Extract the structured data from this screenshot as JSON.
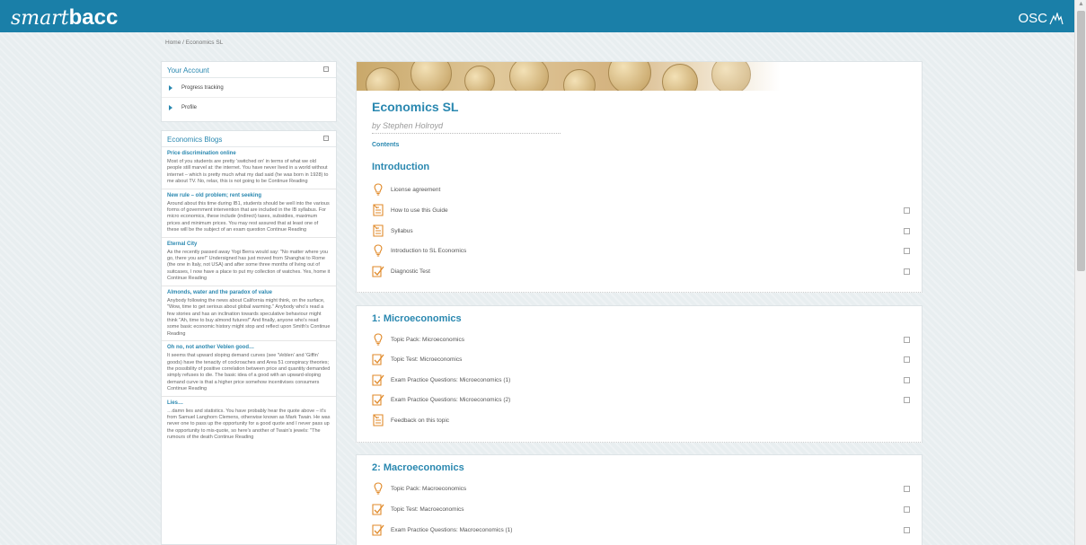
{
  "header": {
    "logo_smart": "smart",
    "logo_bacc": "bacc",
    "osc": "OSC"
  },
  "breadcrumb": {
    "home": "Home",
    "sep": " / ",
    "current": "Economics SL"
  },
  "account": {
    "title": "Your Account",
    "items": [
      {
        "label": "Progress tracking"
      },
      {
        "label": "Profile"
      }
    ]
  },
  "blogs": {
    "title": "Economics Blogs",
    "entries": [
      {
        "title": "Price discrimination online",
        "text": "Most of you students are pretty 'switched on' in terms of what we old people still marvel at: the internet. You have never lived in a world without internet – which is pretty much what my dad said (he was born in 1928) to me about TV. No, relax, this is not going to be Continue Reading"
      },
      {
        "title": "New rule – old problem; rent seeking",
        "text": "Around about this time during IB1, students should be well into the various forms of government intervention that are included in the IB syllabus. For micro economics, these include (indirect) taxes, subsidies, maximum prices and minimum prices. You may rest assured that at least one of these will be the subject of an exam question Continue Reading"
      },
      {
        "title": "Eternal City",
        "text": "As the recently passed away Yogi Berra would say: \"No matter where you go, there you are!\" Undersigned has just moved from Shanghai to Rome (the one in Italy, not USA) and after some three months of living out of suitcases, I now have a place to put my collection of watches. Yes, home it Continue Reading"
      },
      {
        "title": "Almonds, water and the paradox of value",
        "text": "Anybody following the news about California might think, on the surface, \"Wow, time to get serious about global warming.\" Anybody who's read a few stories and has an inclination towards speculative behaviour might think \"Ah, time to buy almond futures!\" And finally, anyone who's read some basic economic history might stop and reflect upon Smith's Continue Reading"
      },
      {
        "title": "Oh no, not another Veblen good…",
        "text": "It seems that upward sloping demand curves (see 'Veblen' and 'Giffin' goods) have the tenacity of cockroaches and Area 51 conspiracy theories; the possibility of positive correlation between price and quantity demanded simply refuses to die. The basic idea of a good with an upward-sloping demand curve is that a higher price somehow incentivises consumers Continue Reading"
      },
      {
        "title": "Lies…",
        "text": "…damn lies and statistics. You have probably hear the quote above – it's from Samuel Langhorn Clemens, otherwise known as Mark Twain. He was never one to pass up the opportunity for a good quote and I never pass up the opportunity to mis-quote, so here's another of Twain's jewels: \"The rumours of the death Continue Reading"
      }
    ]
  },
  "course": {
    "title": "Economics SL",
    "author": "by Stephen Holroyd",
    "contents": "Contents",
    "sections": [
      {
        "title": "Introduction",
        "items": [
          {
            "label": "License agreement",
            "icon": "lightbulb-icon",
            "check": false
          },
          {
            "label": "How to use this Guide",
            "icon": "document-icon",
            "check": true
          },
          {
            "label": "Syllabus",
            "icon": "document-icon",
            "check": true
          },
          {
            "label": "Introduction to SL Economics",
            "icon": "lightbulb-icon",
            "check": true
          },
          {
            "label": "Diagnostic Test",
            "icon": "test-icon",
            "check": true
          }
        ]
      },
      {
        "title": "1: Microeconomics",
        "items": [
          {
            "label": "Topic Pack: Microeconomics",
            "icon": "lightbulb-icon",
            "check": true
          },
          {
            "label": "Topic Test: Microeconomics",
            "icon": "test-icon",
            "check": true
          },
          {
            "label": "Exam Practice Questions: Microeconomics (1)",
            "icon": "test-icon",
            "check": true
          },
          {
            "label": "Exam Practice Questions: Microeconomics (2)",
            "icon": "test-icon",
            "check": true
          },
          {
            "label": "Feedback on this topic",
            "icon": "document-icon",
            "check": false
          }
        ]
      },
      {
        "title": "2: Macroeconomics",
        "items": [
          {
            "label": "Topic Pack: Macroeconomics",
            "icon": "lightbulb-icon",
            "check": true
          },
          {
            "label": "Topic Test: Macroeconomics",
            "icon": "test-icon",
            "check": true
          },
          {
            "label": "Exam Practice Questions: Macroeconomics (1)",
            "icon": "test-icon",
            "check": true
          }
        ]
      }
    ]
  },
  "colors": {
    "brand": "#1a7fa8",
    "link": "#2a88b0",
    "icon": "#e08a2a"
  }
}
